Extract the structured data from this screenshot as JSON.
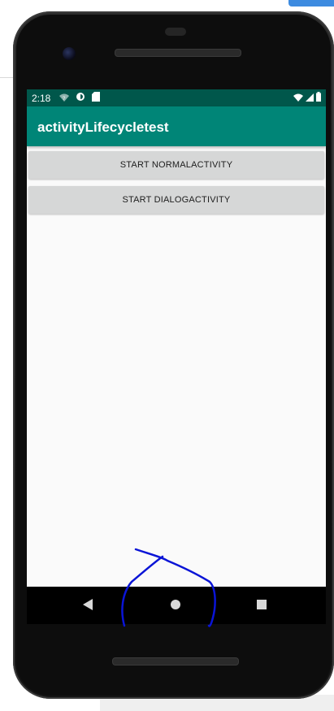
{
  "status_bar": {
    "time": "2:18"
  },
  "app": {
    "title": "activityLifecycletest"
  },
  "buttons": {
    "start_normal": "START NORMALACTIVITY",
    "start_dialog": "START DIALOGACTIVITY"
  },
  "colors": {
    "status_bar": "#00574b",
    "app_bar": "#008577",
    "button": "#d6d7d7",
    "screen_bg": "#fafafa",
    "annotation": "#0a14d6"
  },
  "icons": {
    "status_left": [
      "wifi-icon",
      "data-saver-icon",
      "sd-card-icon"
    ],
    "status_right": [
      "wifi-signal-icon",
      "cell-signal-icon",
      "battery-icon"
    ],
    "nav": [
      "back-icon",
      "home-icon",
      "recents-icon"
    ]
  }
}
